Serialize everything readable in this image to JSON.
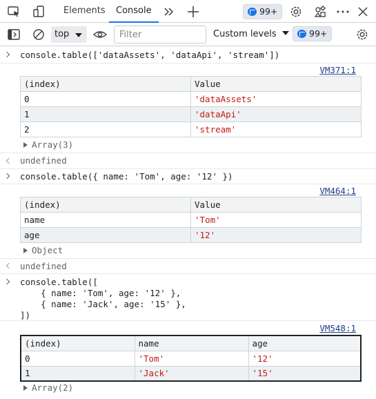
{
  "tabs": {
    "elements": "Elements",
    "console": "Console"
  },
  "issues_badge": "99+",
  "toolbar": {
    "context": "top",
    "filter_placeholder": "Filter",
    "levels": "Custom levels",
    "issues_badge": "99+"
  },
  "entries": {
    "e1": {
      "input": "console.table(['dataAssets', 'dataApi', 'stream'])",
      "source": "VM371:1",
      "headers": [
        "(index)",
        "Value"
      ],
      "rows": [
        [
          "0",
          "'dataAssets'"
        ],
        [
          "1",
          "'dataApi'"
        ],
        [
          "2",
          "'stream'"
        ]
      ],
      "summary": "Array(3)",
      "result": "undefined"
    },
    "e2": {
      "input": "console.table({ name: 'Tom', age: '12' })",
      "source": "VM464:1",
      "headers": [
        "(index)",
        "Value"
      ],
      "rows": [
        [
          "name",
          "'Tom'"
        ],
        [
          "age",
          "'12'"
        ]
      ],
      "summary": "Object",
      "result": "undefined"
    },
    "e3": {
      "input_lines": [
        "console.table([",
        "    { name: 'Tom', age: '12' },",
        "    { name: 'Jack', age: '15' },",
        "])"
      ],
      "source": "VM548:1",
      "headers": [
        "(index)",
        "name",
        "age"
      ],
      "rows": [
        [
          "0",
          "'Tom'",
          "'12'"
        ],
        [
          "1",
          "'Jack'",
          "'15'"
        ]
      ],
      "summary": "Array(2)"
    }
  }
}
